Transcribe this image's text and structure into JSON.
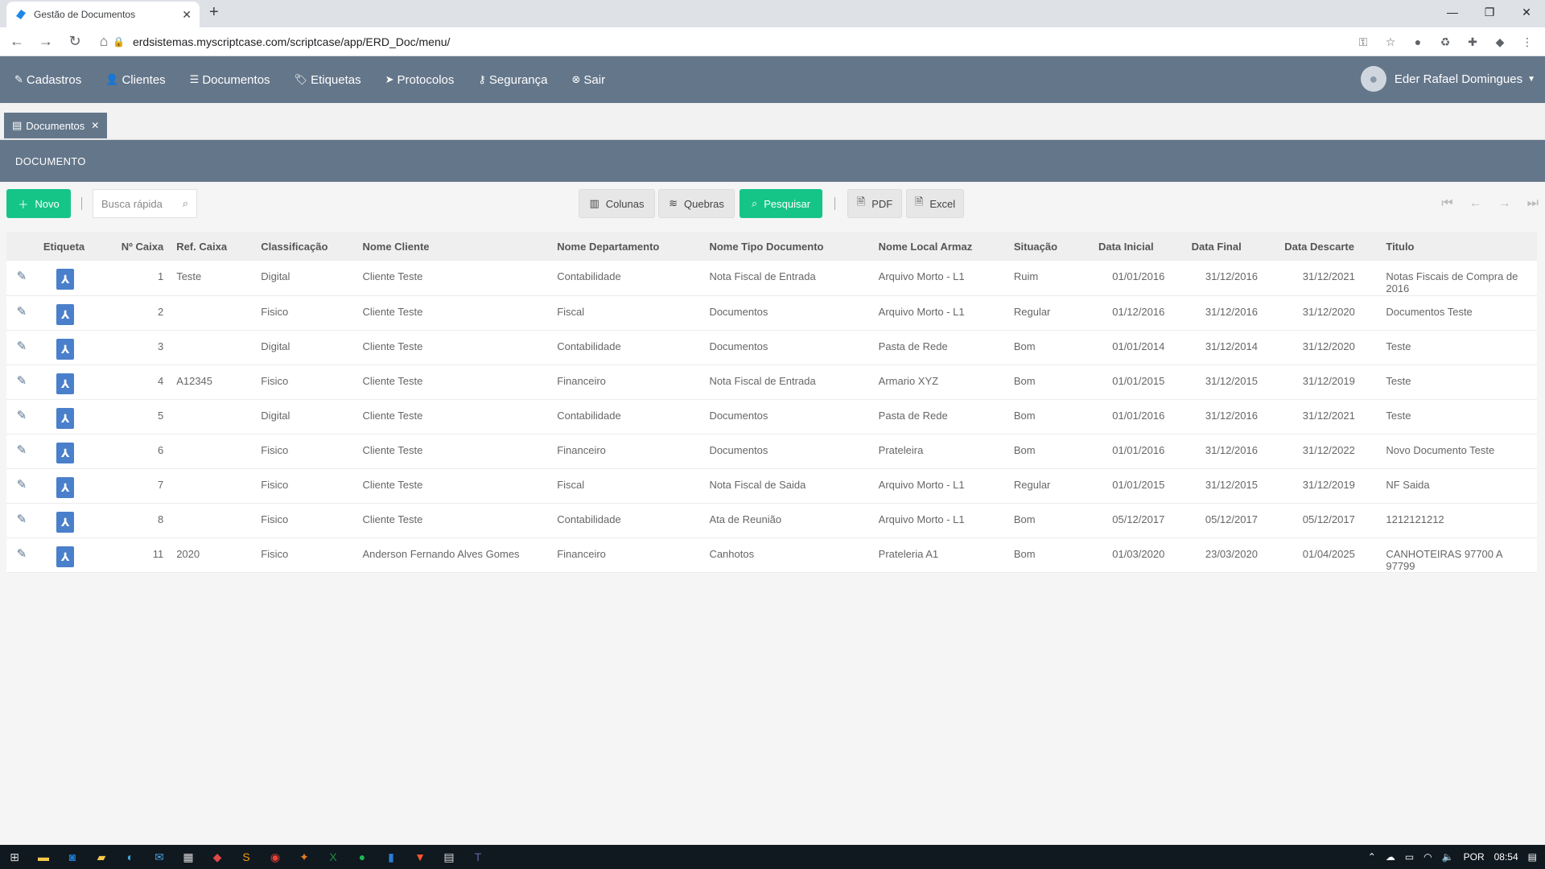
{
  "browser": {
    "tab_title": "Gestão de Documentos",
    "tab_close": "✕",
    "new_tab": "+",
    "url": "erdsistemas.myscriptcase.com/scriptcase/app/ERD_Doc/menu/",
    "window": {
      "minimize": "—",
      "maximize": "❐",
      "close": "✕"
    }
  },
  "menu": {
    "items": [
      {
        "label": "Cadastros",
        "icon": "edit-icon"
      },
      {
        "label": "Clientes",
        "icon": "user-icon"
      },
      {
        "label": "Documentos",
        "icon": "list-icon"
      },
      {
        "label": "Etiquetas",
        "icon": "tag-icon"
      },
      {
        "label": "Protocolos",
        "icon": "send-icon"
      },
      {
        "label": "Segurança",
        "icon": "key-icon"
      },
      {
        "label": "Sair",
        "icon": "close-circle-icon"
      }
    ],
    "user": "Eder Rafael Domingues"
  },
  "app_tab": {
    "label": "Documentos",
    "close": "✕"
  },
  "section_title": "DOCUMENTO",
  "toolbar": {
    "novo": "Novo",
    "search_placeholder": "Busca rápida",
    "colunas": "Colunas",
    "quebras": "Quebras",
    "pesquisar": "Pesquisar",
    "pdf": "PDF",
    "excel": "Excel"
  },
  "table": {
    "headers": [
      "",
      "Etiqueta",
      "Nº Caixa",
      "Ref. Caixa",
      "Classificação",
      "Nome Cliente",
      "Nome Departamento",
      "Nome Tipo Documento",
      "Nome Local Armaz",
      "Situação",
      "Data Inicial",
      "Data Final",
      "Data Descarte",
      "Titulo"
    ],
    "rows": [
      [
        "1",
        "Teste",
        "Digital",
        "Cliente Teste",
        "Contabilidade",
        "Nota Fiscal de Entrada",
        "Arquivo Morto - L1",
        "Ruim",
        "01/01/2016",
        "31/12/2016",
        "31/12/2021",
        "Notas Fiscais de Compra de 2016"
      ],
      [
        "2",
        "",
        "Fisico",
        "Cliente Teste",
        "Fiscal",
        "Documentos",
        "Arquivo Morto - L1",
        "Regular",
        "01/12/2016",
        "31/12/2016",
        "31/12/2020",
        "Documentos Teste"
      ],
      [
        "3",
        "",
        "Digital",
        "Cliente Teste",
        "Contabilidade",
        "Documentos",
        "Pasta de Rede",
        "Bom",
        "01/01/2014",
        "31/12/2014",
        "31/12/2020",
        "Teste"
      ],
      [
        "4",
        "A12345",
        "Fisico",
        "Cliente Teste",
        "Financeiro",
        "Nota Fiscal de Entrada",
        "Armario XYZ",
        "Bom",
        "01/01/2015",
        "31/12/2015",
        "31/12/2019",
        "Teste"
      ],
      [
        "5",
        "",
        "Digital",
        "Cliente Teste",
        "Contabilidade",
        "Documentos",
        "Pasta de Rede",
        "Bom",
        "01/01/2016",
        "31/12/2016",
        "31/12/2021",
        "Teste"
      ],
      [
        "6",
        "",
        "Fisico",
        "Cliente Teste",
        "Financeiro",
        "Documentos",
        "Prateleira",
        "Bom",
        "01/01/2016",
        "31/12/2016",
        "31/12/2022",
        "Novo Documento Teste"
      ],
      [
        "7",
        "",
        "Fisico",
        "Cliente Teste",
        "Fiscal",
        "Nota Fiscal de Saida",
        "Arquivo Morto - L1",
        "Regular",
        "01/01/2015",
        "31/12/2015",
        "31/12/2019",
        "NF Saida"
      ],
      [
        "8",
        "",
        "Fisico",
        "Cliente Teste",
        "Contabilidade",
        "Ata de Reunião",
        "Arquivo Morto - L1",
        "Bom",
        "05/12/2017",
        "05/12/2017",
        "05/12/2017",
        "1212121212"
      ],
      [
        "11",
        "2020",
        "Fisico",
        "Anderson Fernando Alves Gomes",
        "Financeiro",
        "Canhotos",
        "Prateleria A1",
        "Bom",
        "01/03/2020",
        "23/03/2020",
        "01/04/2025",
        "CANHOTEIRAS 97700 A 97799"
      ]
    ]
  },
  "taskbar": {
    "language": "POR",
    "time": "08:54"
  },
  "colors": {
    "header_bg": "#64768a",
    "accent_green": "#15c587"
  }
}
